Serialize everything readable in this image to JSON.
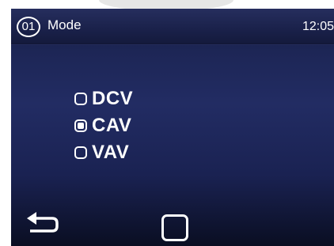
{
  "header": {
    "screen_number": "01",
    "title": "Mode",
    "time": "12:05"
  },
  "mode_options": [
    {
      "label": "DCV",
      "selected": false
    },
    {
      "label": "CAV",
      "selected": true
    },
    {
      "label": "VAV",
      "selected": false
    }
  ],
  "footer": {
    "back_icon": "return-arrow-icon",
    "home_icon": "square-icon"
  },
  "colors": {
    "screen_background": "#222c63",
    "header_background": "#1a214a",
    "foreground": "#ffffff"
  }
}
